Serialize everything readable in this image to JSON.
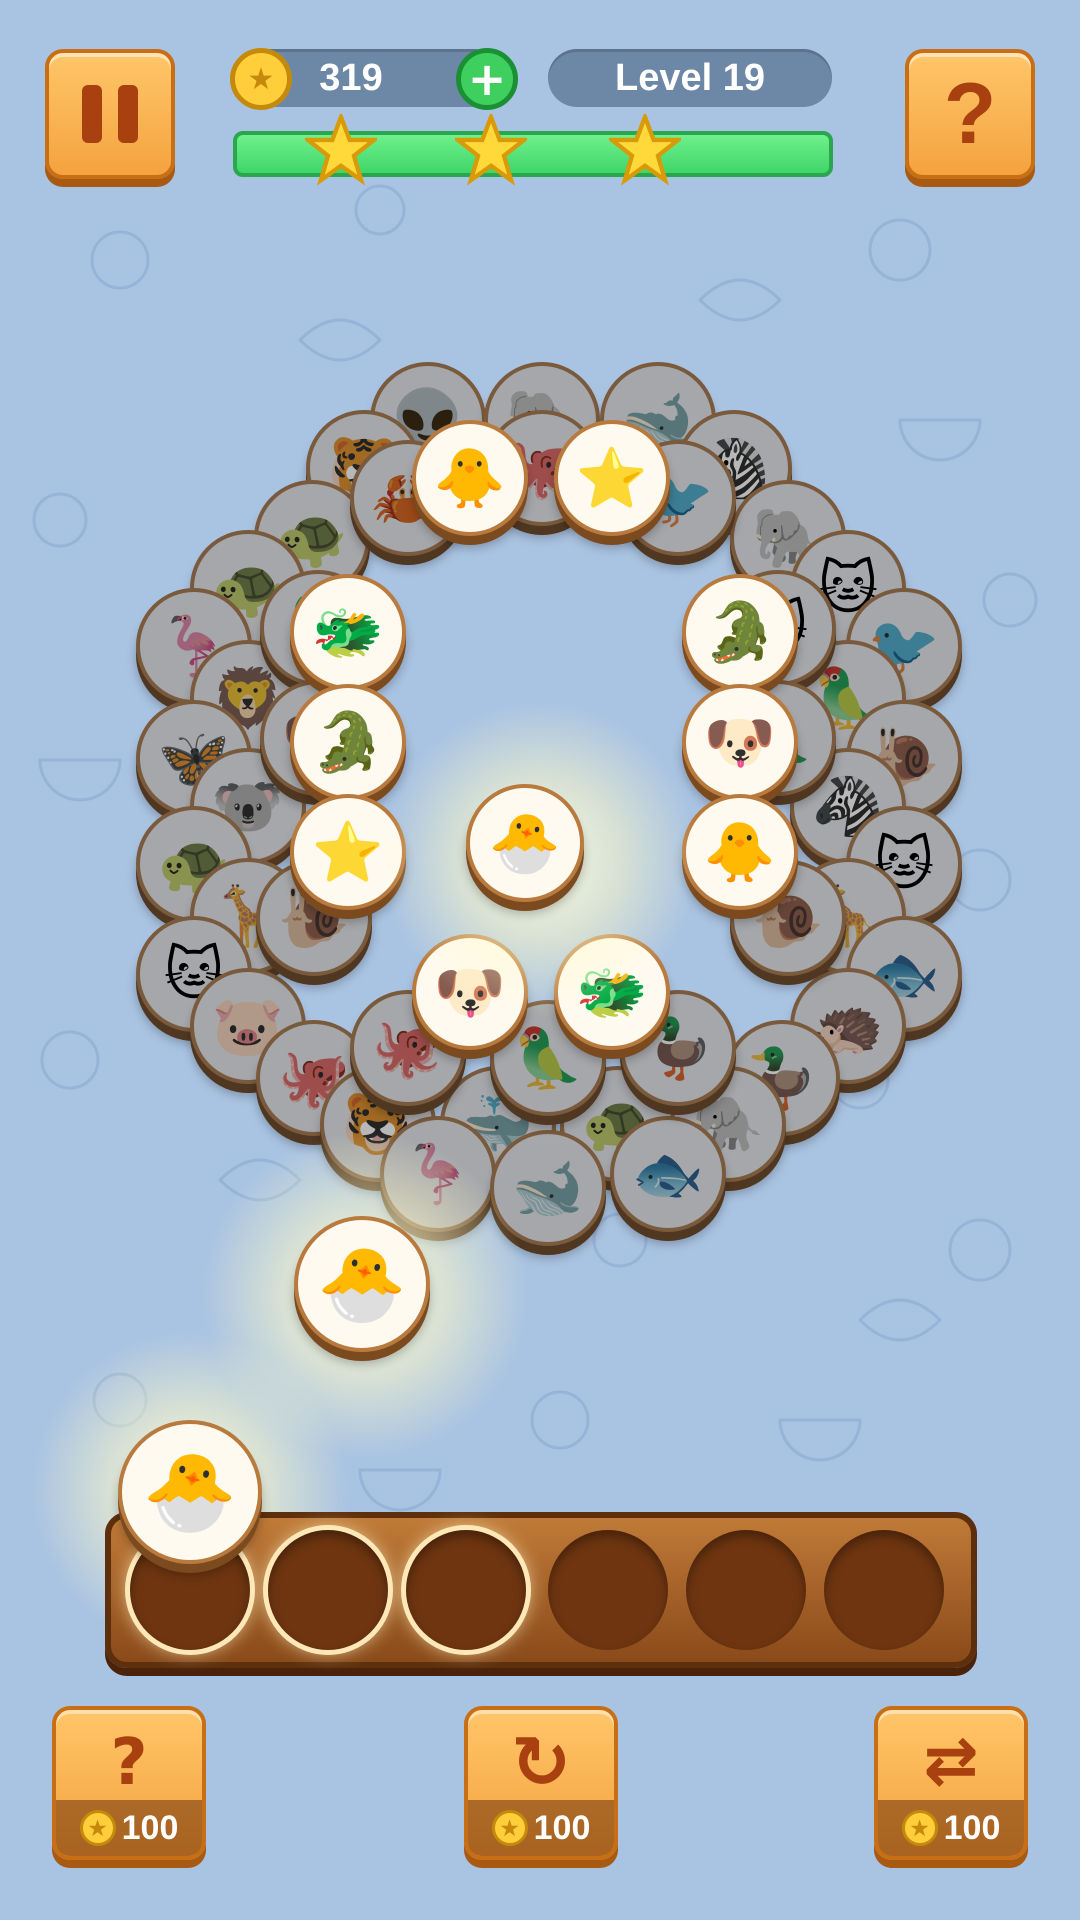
{
  "hud": {
    "coins": "319",
    "level": "Level 19",
    "pause_icon": "pause-icon",
    "help_icon": "help-icon",
    "progress": 1.0,
    "stars_earned": 3
  },
  "tray": {
    "slot_count": 6,
    "filled": 0
  },
  "tools": [
    {
      "name": "hint",
      "icon": "hint-icon",
      "cost": "100"
    },
    {
      "name": "undo",
      "icon": "undo-icon",
      "cost": "100"
    },
    {
      "name": "shuffle",
      "icon": "shuffle-icon",
      "cost": "100"
    }
  ],
  "colors": {
    "accent": "#f4a33f",
    "progress": "#3fd66a",
    "tray": "#8a4a1a",
    "background": "#a9c3e2"
  }
}
